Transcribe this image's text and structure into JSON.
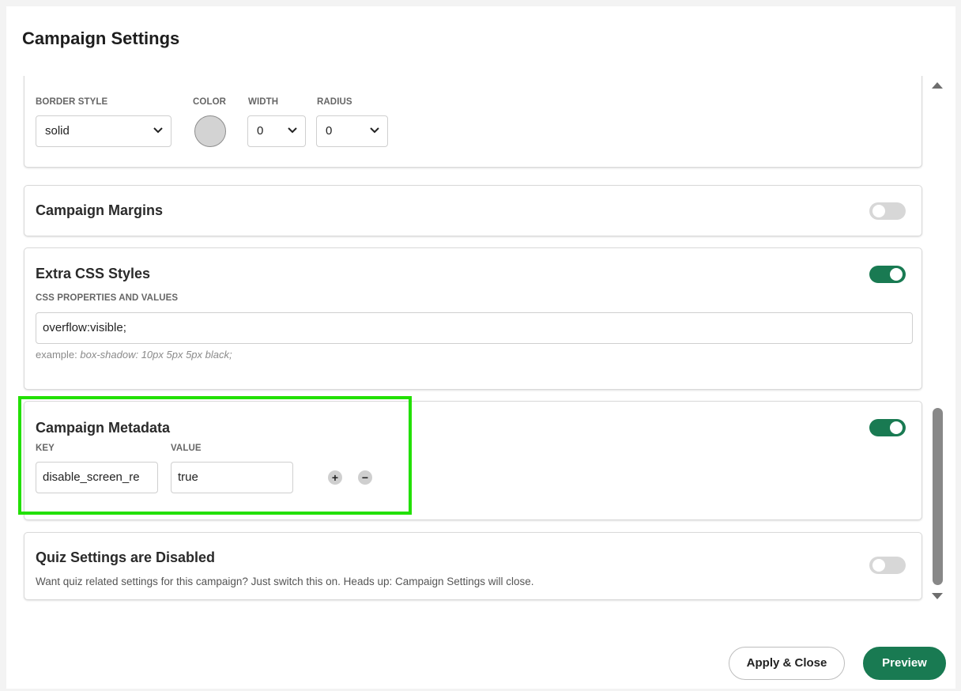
{
  "modal": {
    "title": "Campaign Settings"
  },
  "border_card": {
    "labels": {
      "border_style": "BORDER STYLE",
      "color": "COLOR",
      "width": "WIDTH",
      "radius": "RADIUS"
    },
    "border_style_value": "solid",
    "width_value": "0",
    "radius_value": "0",
    "swatch_color": "#d3d3d3"
  },
  "margins_card": {
    "title": "Campaign Margins",
    "toggle_on": false
  },
  "css_card": {
    "title": "Extra CSS Styles",
    "toggle_on": true,
    "field_label": "CSS PROPERTIES AND VALUES",
    "value": "overflow:visible;",
    "hint_prefix": "example:",
    "hint_example": "box-shadow: 10px 5px 5px black;"
  },
  "metadata_card": {
    "title": "Campaign Metadata",
    "toggle_on": true,
    "key_label": "KEY",
    "value_label": "VALUE",
    "key_value": "disable_screen_re",
    "value_value": "true",
    "add_symbol": "+",
    "remove_symbol": "−"
  },
  "quiz_card": {
    "title": "Quiz Settings are Disabled",
    "description": "Want quiz related settings for this campaign? Just switch this on. Heads up: Campaign Settings will close.",
    "toggle_on": false
  },
  "footer": {
    "apply_label": "Apply & Close",
    "preview_label": "Preview"
  },
  "colors": {
    "accent": "#197a52",
    "highlight": "#22e000"
  }
}
